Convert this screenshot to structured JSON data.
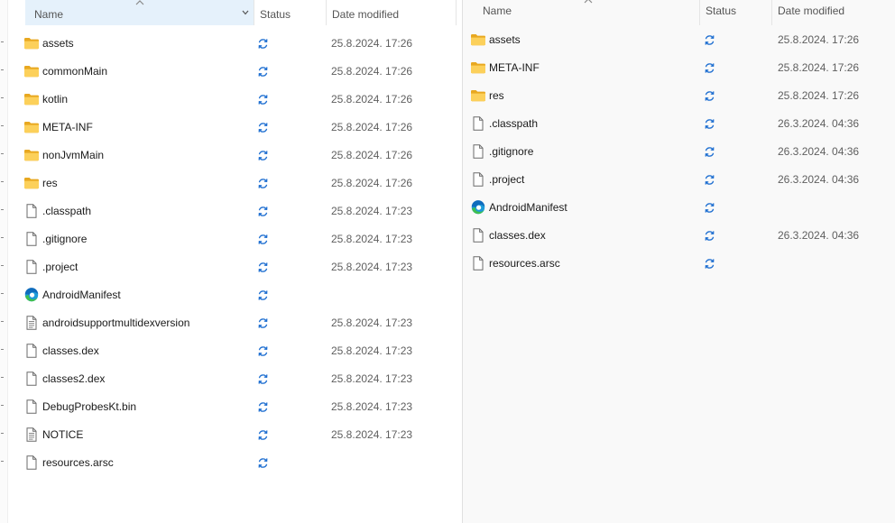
{
  "left_pane": {
    "columns": {
      "name": "Name",
      "status": "Status",
      "date": "Date modified"
    },
    "files": [
      {
        "name": "assets",
        "type": "folder",
        "date": "25.8.2024. 17:26"
      },
      {
        "name": "commonMain",
        "type": "folder",
        "date": "25.8.2024. 17:26"
      },
      {
        "name": "kotlin",
        "type": "folder",
        "date": "25.8.2024. 17:26"
      },
      {
        "name": "META-INF",
        "type": "folder",
        "date": "25.8.2024. 17:26"
      },
      {
        "name": "nonJvmMain",
        "type": "folder",
        "date": "25.8.2024. 17:26"
      },
      {
        "name": "res",
        "type": "folder",
        "date": "25.8.2024. 17:26"
      },
      {
        "name": ".classpath",
        "type": "file",
        "date": "25.8.2024. 17:23"
      },
      {
        "name": ".gitignore",
        "type": "file",
        "date": "25.8.2024. 17:23"
      },
      {
        "name": ".project",
        "type": "file",
        "date": "25.8.2024. 17:23"
      },
      {
        "name": "AndroidManifest",
        "type": "edge",
        "date": ""
      },
      {
        "name": "androidsupportmultidexversion",
        "type": "text",
        "date": "25.8.2024. 17:23"
      },
      {
        "name": "classes.dex",
        "type": "file",
        "date": "25.8.2024. 17:23"
      },
      {
        "name": "classes2.dex",
        "type": "file",
        "date": "25.8.2024. 17:23"
      },
      {
        "name": "DebugProbesKt.bin",
        "type": "file",
        "date": "25.8.2024. 17:23"
      },
      {
        "name": "NOTICE",
        "type": "text",
        "date": "25.8.2024. 17:23"
      },
      {
        "name": "resources.arsc",
        "type": "file",
        "date": ""
      }
    ]
  },
  "right_pane": {
    "columns": {
      "name": "Name",
      "status": "Status",
      "date": "Date modified"
    },
    "files": [
      {
        "name": "assets",
        "type": "folder",
        "date": "25.8.2024. 17:26"
      },
      {
        "name": "META-INF",
        "type": "folder",
        "date": "25.8.2024. 17:26"
      },
      {
        "name": "res",
        "type": "folder",
        "date": "25.8.2024. 17:26"
      },
      {
        "name": ".classpath",
        "type": "file",
        "date": "26.3.2024. 04:36"
      },
      {
        "name": ".gitignore",
        "type": "file",
        "date": "26.3.2024. 04:36"
      },
      {
        "name": ".project",
        "type": "file",
        "date": "26.3.2024. 04:36"
      },
      {
        "name": "AndroidManifest",
        "type": "edge",
        "date": ""
      },
      {
        "name": "classes.dex",
        "type": "file",
        "date": "26.3.2024. 04:36"
      },
      {
        "name": "resources.arsc",
        "type": "file",
        "date": ""
      }
    ]
  },
  "icons": {
    "folder": "folder-icon",
    "file": "file-icon",
    "text": "text-file-icon",
    "edge": "edge-browser-icon",
    "status": "sync-status-icon"
  },
  "colors": {
    "folder": "#f8c84a",
    "status": "#1f6fd1",
    "header_active": "#e5f1fb"
  }
}
